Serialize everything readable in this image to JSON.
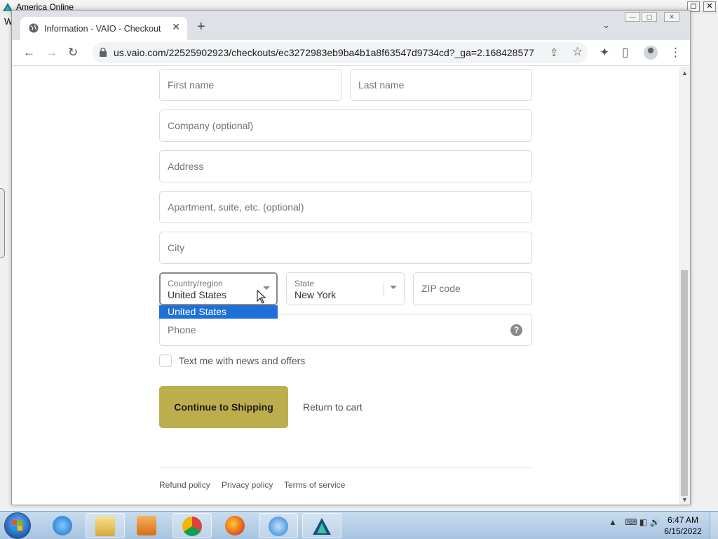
{
  "host": {
    "title": "America Online",
    "menu_letter": "W",
    "ctrl_minimize": "▭",
    "ctrl_restore": "◻",
    "ctrl_close": "✕"
  },
  "browser": {
    "tab_title": "Information - VAIO - Checkout",
    "tab_close": "✕",
    "new_tab": "+",
    "tabs_menu": "⌄",
    "url": "us.vaio.com/22525902923/checkouts/ec3272983eb9ba4b1a8f63547d9734cd?_ga=2.168428577.1...",
    "back": "←",
    "forward": "→",
    "reload": "↻",
    "share": "⇪",
    "star": "☆",
    "extensions": "✦",
    "sidepanel": "▯",
    "menu": "⋮",
    "win_min": "—",
    "win_max": "▢",
    "win_close": "✕"
  },
  "form": {
    "first_name_placeholder": "First name",
    "last_name_placeholder": "Last name",
    "company_placeholder": "Company (optional)",
    "address_placeholder": "Address",
    "apartment_placeholder": "Apartment, suite, etc. (optional)",
    "city_placeholder": "City",
    "country_label": "Country/region",
    "country_value": "United States",
    "state_label": "State",
    "state_value": "New York",
    "zip_placeholder": "ZIP code",
    "phone_placeholder": "Phone",
    "phone_help": "?",
    "country_dropdown_option": "United States",
    "sms_opt_in_label": "Text me with news and offers",
    "continue_button": "Continue to Shipping",
    "return_link": "Return to cart"
  },
  "footer": {
    "links": [
      "Refund policy",
      "Privacy policy",
      "Terms of service"
    ]
  },
  "taskbar": {
    "time": "6:47 AM",
    "date": "6/15/2022",
    "tray_arrow": "▲",
    "tray_icons": "⌨ ◧ 🔊"
  },
  "colors": {
    "continue_button_bg": "#bdae4d",
    "dropdown_highlight": "#1e6fd9",
    "field_border": "#d9d9d9"
  },
  "icons": {
    "host_logo": "triangle-logo-icon",
    "tab_favicon": "globe-icon",
    "lock": "lock-icon",
    "profile": "profile-icon",
    "start": "windows-start-icon",
    "taskbar_apps": [
      "internet-explorer-icon",
      "file-explorer-icon",
      "media-player-icon",
      "chrome-icon",
      "firefox-icon",
      "quicktime-icon",
      "aol-icon"
    ]
  }
}
